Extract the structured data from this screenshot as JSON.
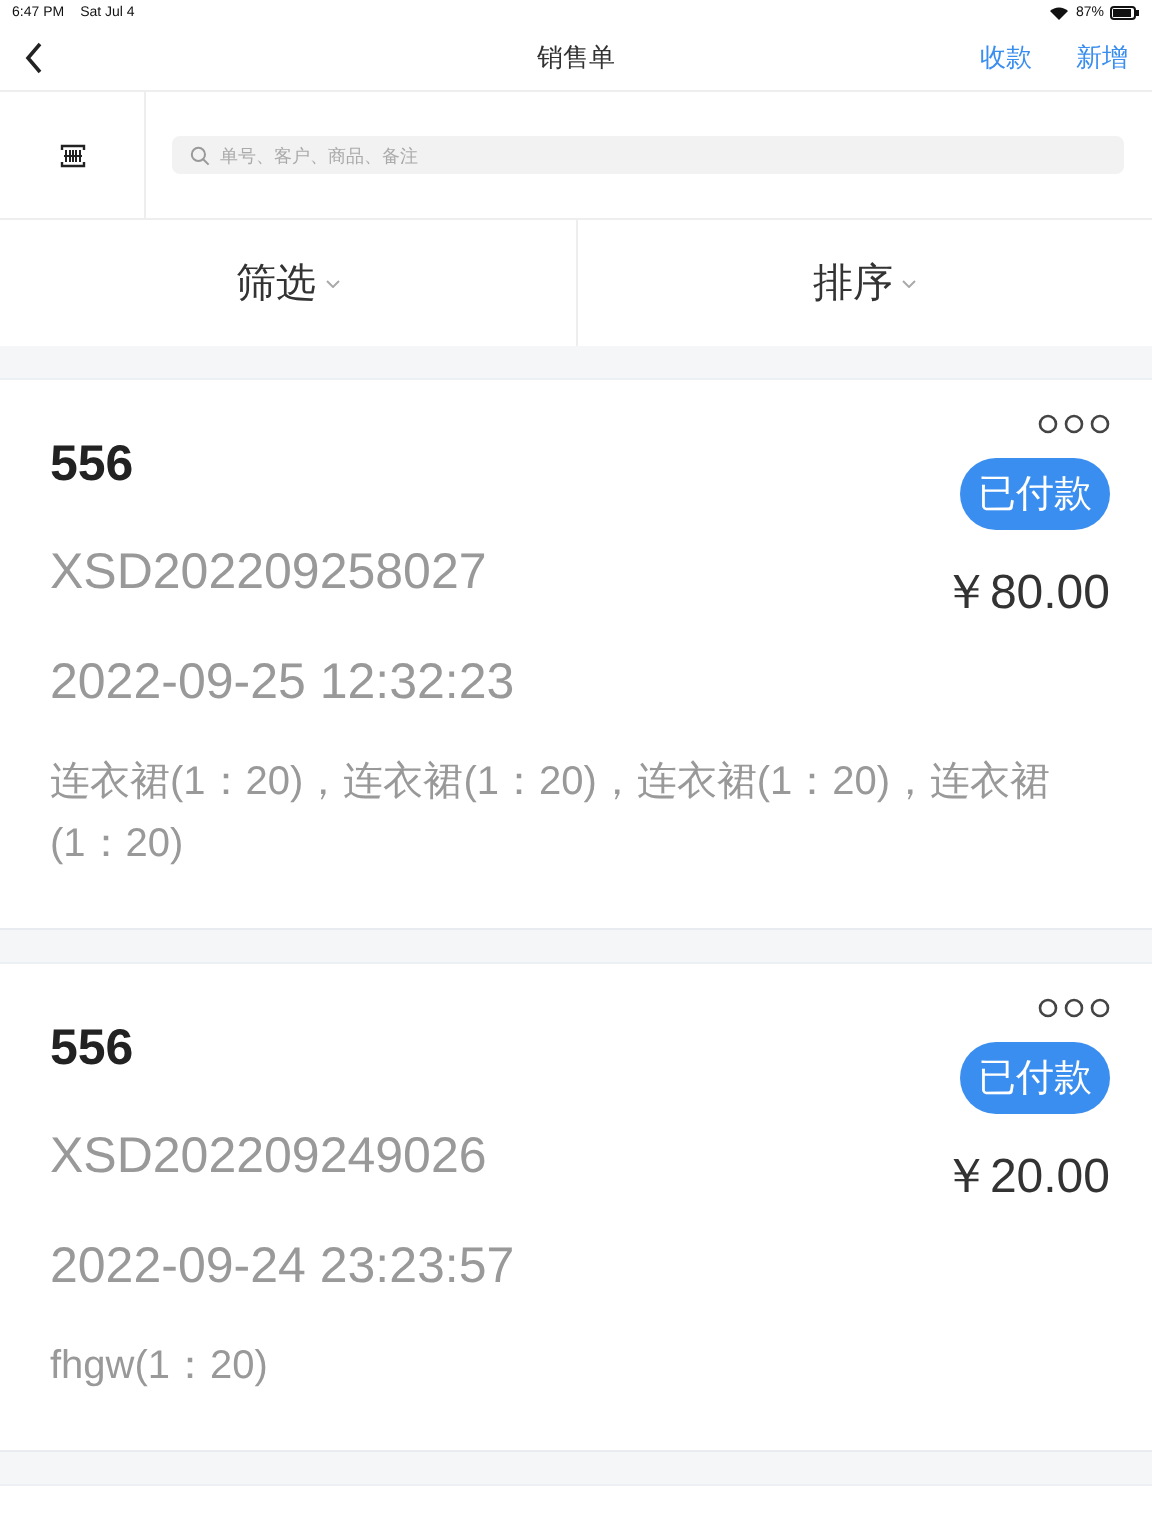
{
  "status_bar": {
    "time": "6:47 PM",
    "date": "Sat Jul 4",
    "battery": "87%"
  },
  "nav": {
    "title": "销售单",
    "actions": [
      "收款",
      "新增"
    ]
  },
  "search": {
    "placeholder": "单号、客户、商品、备注"
  },
  "toolbar": [
    {
      "label": "筛选"
    },
    {
      "label": "排序"
    }
  ],
  "orders": [
    {
      "customer": "556",
      "number": "XSD202209258027",
      "time": "2022-09-25 12:32:23",
      "items": "连衣裙(1：20)，连衣裙(1：20)，连衣裙(1：20)，连衣裙(1：20)",
      "status": "已付款",
      "amount": "￥80.00"
    },
    {
      "customer": "556",
      "number": "XSD202209249026",
      "time": "2022-09-24 23:23:57",
      "items": "fhgw(1：20)",
      "status": "已付款",
      "amount": "￥20.00"
    }
  ]
}
